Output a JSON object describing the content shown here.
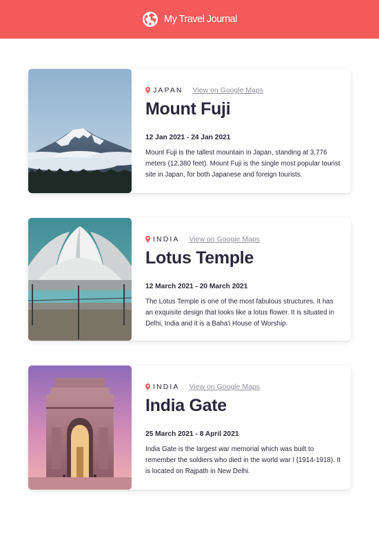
{
  "header": {
    "title": "My Travel Journal",
    "icon": "globe-icon",
    "background_color": "#f55a5a"
  },
  "entries": [
    {
      "country": "JAPAN",
      "maps_link": "View on Google Maps",
      "title": "Mount Fuji",
      "dates": "12 Jan 2021 - 24 Jan 2021",
      "description": "Mount Fuji is the tallest mountain in Japan, standing at 3,776 meters (12,380 feet). Mount Fuji is the single most popular tourist site in Japan, for both Japanese and foreign tourists."
    },
    {
      "country": "INDIA",
      "maps_link": "View on Google Maps",
      "title": "Lotus Temple",
      "dates": "12 March 2021 - 20 March 2021",
      "description": "The Lotus Temple is one of the most fabulous structures. It has an exquisite design that looks like a lotus flower. It is situated in Delhi, India and it is a Baha'i House of Worship."
    },
    {
      "country": "INDIA",
      "maps_link": "View on Google Maps",
      "title": "India Gate",
      "dates": "25 March 2021 - 8 April 2021",
      "description": "India Gate is the largest war memorial which was built to remember the soldiers who died in the world war I (1914-1918). It is located on Rajpath in New Delhi."
    }
  ],
  "colors": {
    "accent": "#f55a5a",
    "text": "#2b283a",
    "muted": "#918e9b"
  }
}
